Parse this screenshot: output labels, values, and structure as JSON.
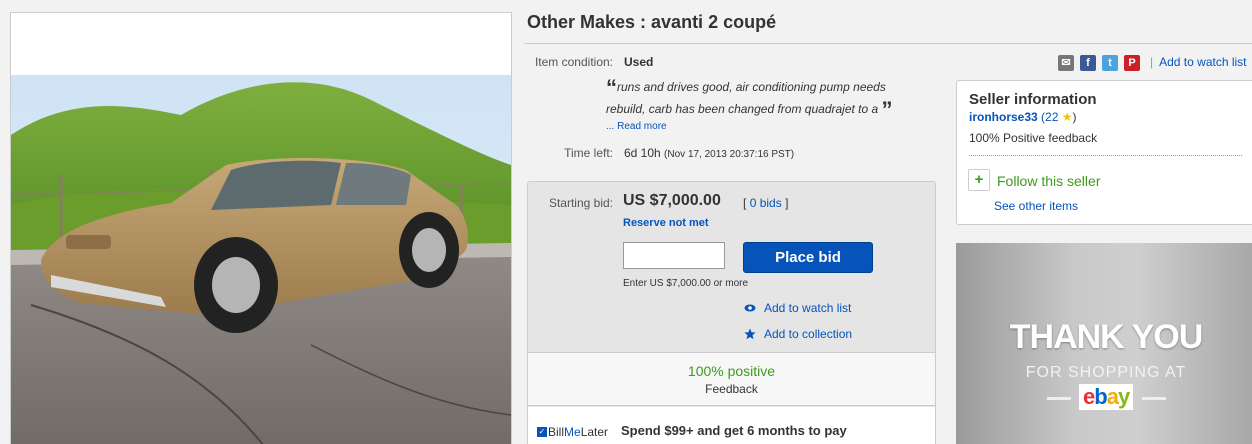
{
  "listing": {
    "title": "Other Makes : avanti 2 coupé",
    "condition_label": "Item condition:",
    "condition_value": "Used",
    "description_snippet": "runs and drives good, air conditioning pump needs rebuild, carb has been changed from quadrajet to a",
    "open_quote": "“",
    "close_quote": "”",
    "read_more_prefix": "...",
    "read_more": "Read more",
    "time_left_label": "Time left:",
    "time_left_value": "6d 10h",
    "time_left_end": "(Nov 17, 2013  20:37:16 PST)"
  },
  "bid": {
    "starting_bid_label": "Starting bid:",
    "price": "US $7,000.00",
    "bids_open": "[",
    "bids_count": "0 bids",
    "bids_close": "]",
    "reserve": "Reserve not met",
    "input_value": "",
    "place_bid": "Place bid",
    "enter_note": "Enter US $7,000.00 or more",
    "add_watch": "Add to watch list",
    "add_collection": "Add to collection",
    "feedback_pct": "100% positive",
    "feedback_label": "Feedback"
  },
  "billmelater": {
    "logo_bill": "Bill",
    "logo_me": "Me",
    "logo_later": "Later",
    "promo": "Spend $99+ and get 6 months to pay"
  },
  "share": {
    "bar": "|",
    "watch": "Add to watch list"
  },
  "seller": {
    "heading": "Seller information",
    "name": "ironhorse33",
    "score_open": "(",
    "score": "22",
    "score_close": ")",
    "positive": "100% Positive feedback",
    "follow": "Follow this seller",
    "see_other": "See other items"
  },
  "banner": {
    "thank_you": "THANK YOU",
    "for_shopping": "FOR SHOPPING AT",
    "brand_e": "e",
    "brand_b": "b",
    "brand_a": "a",
    "brand_y": "y"
  },
  "colors": {
    "link": "#0654ba",
    "place_bid_bg": "#0654ba",
    "positive_green": "#3c9b1c"
  },
  "icons": {
    "share": [
      "email-icon",
      "facebook-icon",
      "twitter-icon",
      "pinterest-icon"
    ],
    "watch": "eye-icon",
    "collection": "star-icon",
    "follow": "plus-icon",
    "rating": "star-icon"
  }
}
